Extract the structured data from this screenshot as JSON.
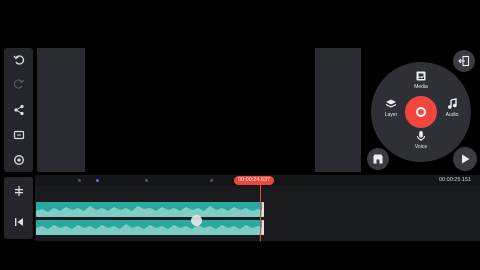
{
  "wheel": {
    "media_label": "Media",
    "layer_label": "Layer",
    "audio_label": "Audio",
    "voice_label": "Voice"
  },
  "timeline": {
    "current_time": "00:00:24.637",
    "total_time": "00:00:25.151"
  },
  "colors": {
    "accent": "#f2453d",
    "audio_track": "#2aa9a0",
    "panel": "#25262b"
  },
  "icons": {
    "rail": [
      "undo-icon",
      "redo-icon",
      "share-icon",
      "fullscreen-icon",
      "settings-icon"
    ],
    "rail2": [
      "split-icon",
      "skip-to-start-icon"
    ]
  }
}
